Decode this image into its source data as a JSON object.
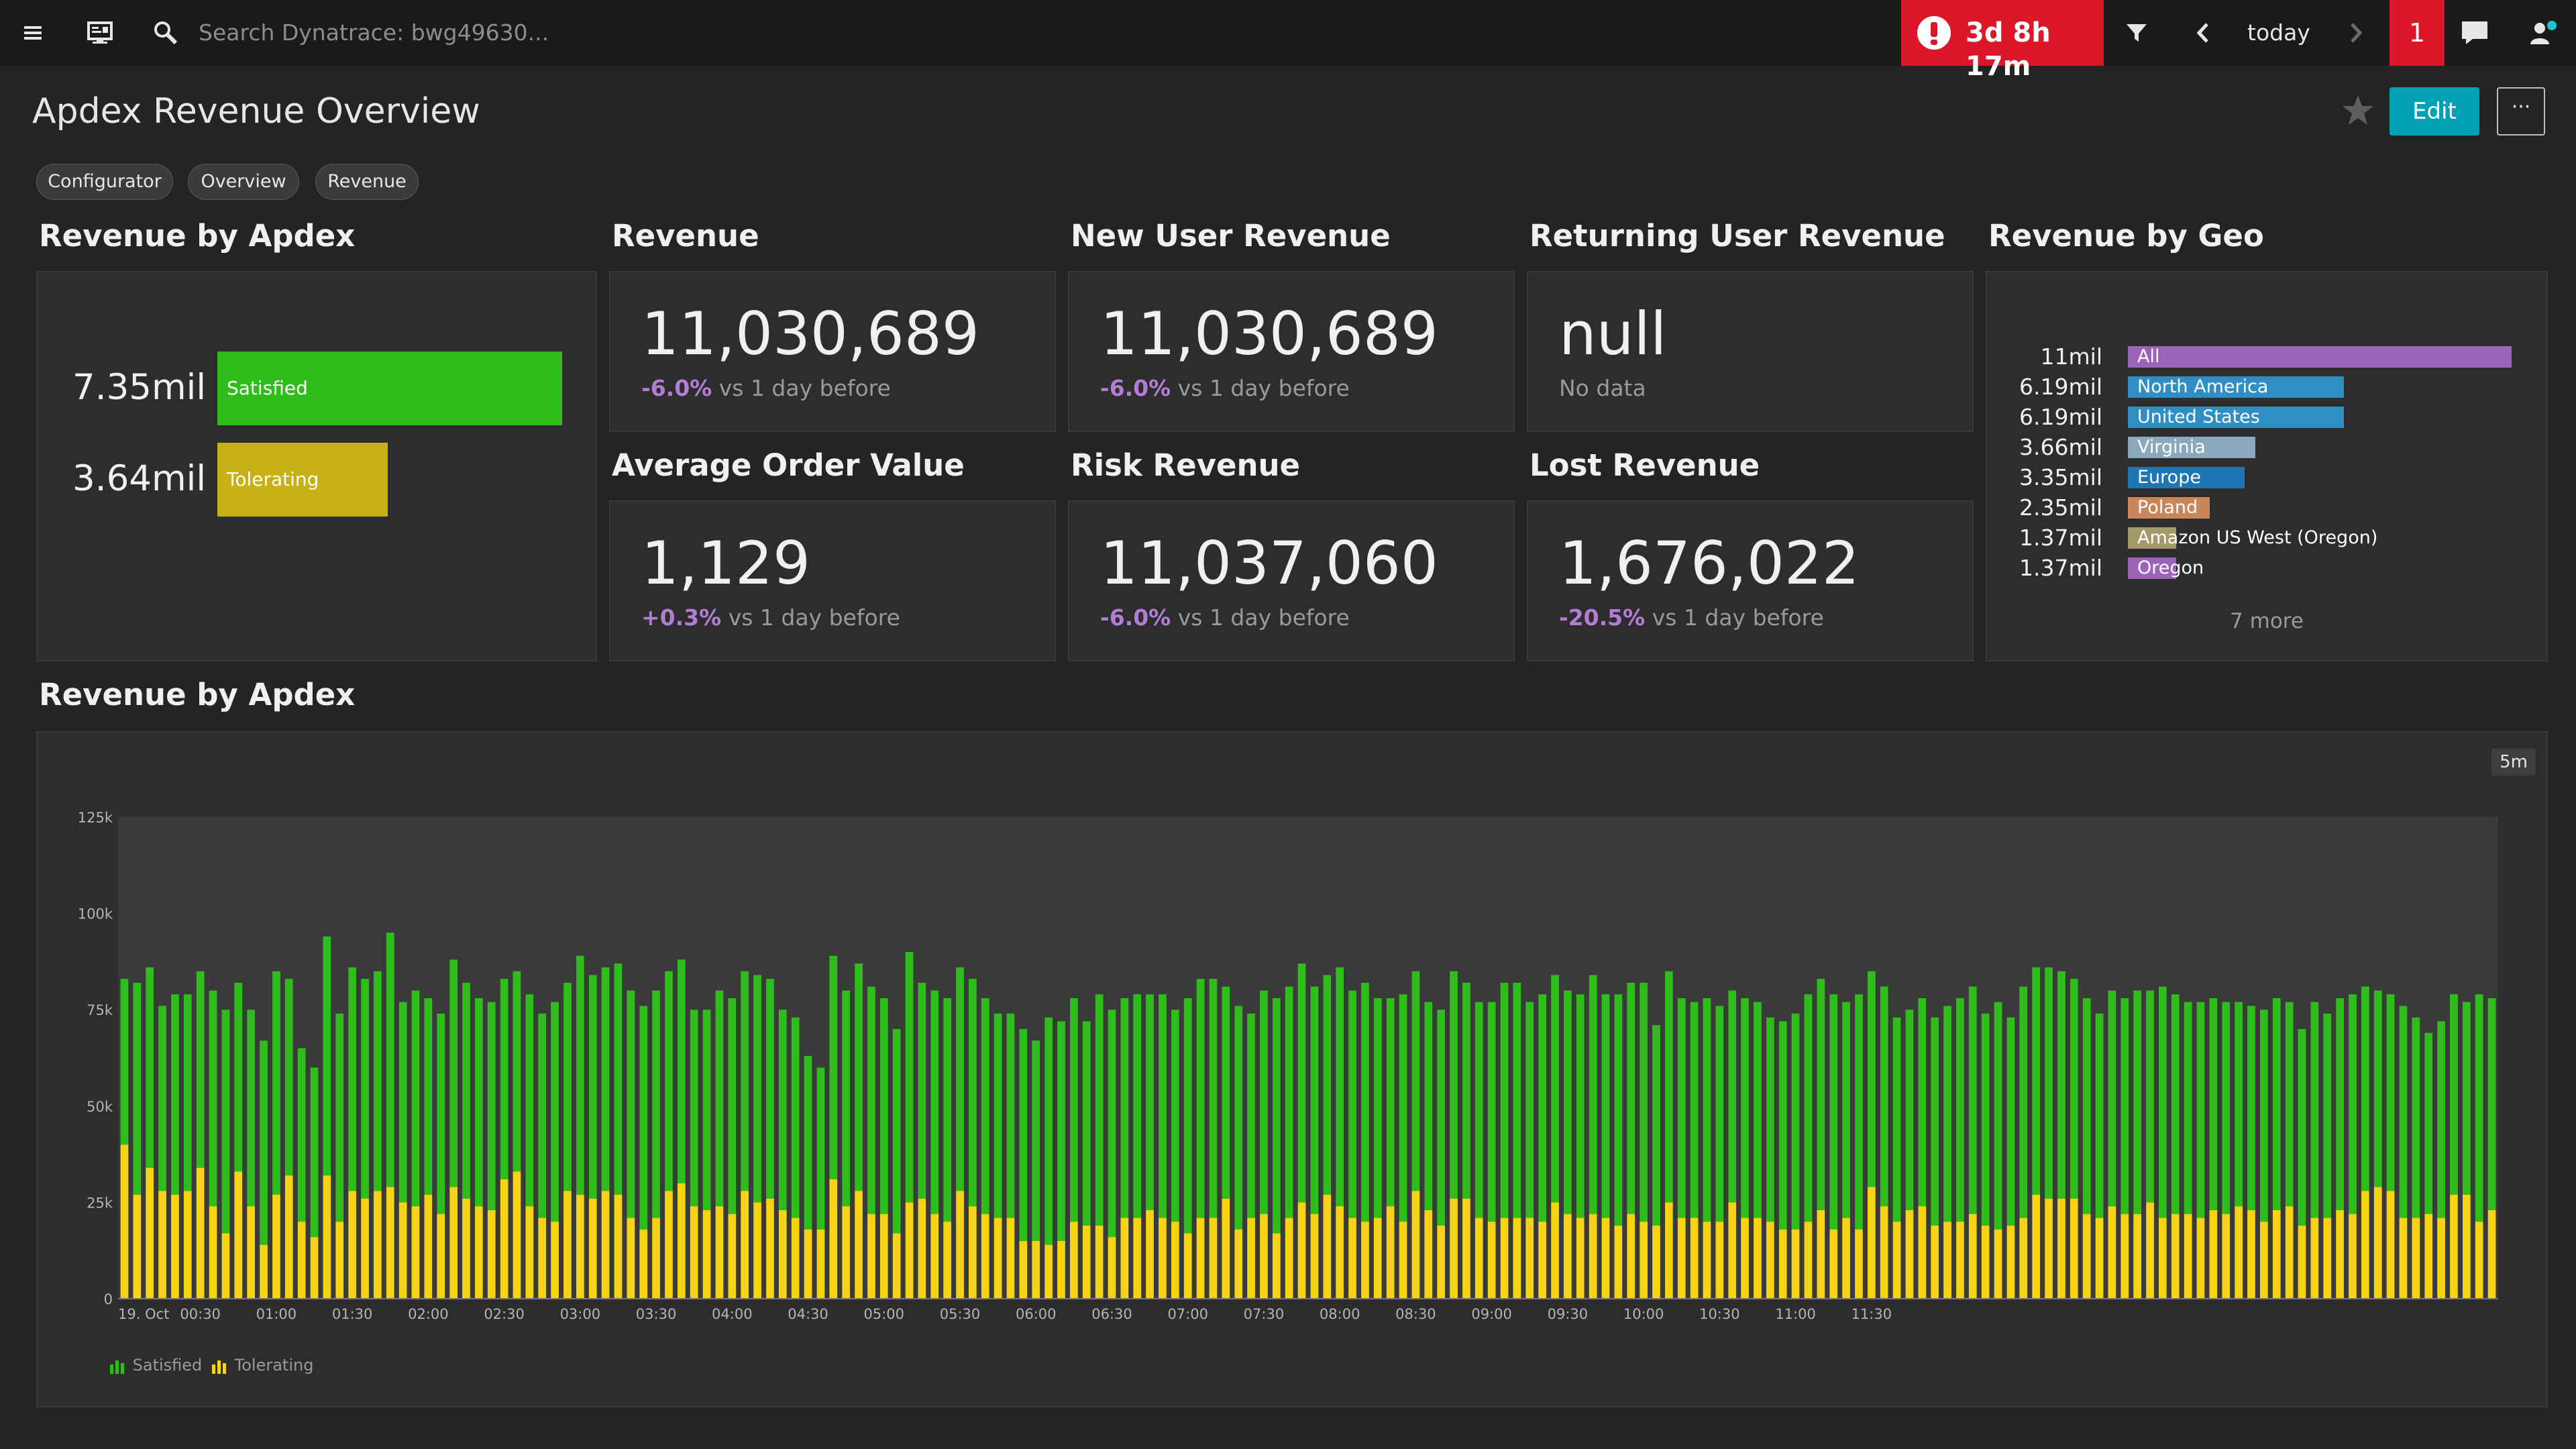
{
  "topbar": {
    "search_placeholder": "Search Dynatrace: bwg49630...",
    "problem_duration": "3d 8h 17m",
    "timeframe_label": "today",
    "notification_count": "1"
  },
  "header": {
    "title": "Apdex Revenue Overview",
    "edit_label": "Edit",
    "more_label": "···"
  },
  "tags": [
    "Configurator",
    "Overview",
    "Revenue"
  ],
  "tiles": {
    "revenue_by_apdex": {
      "title": "Revenue by Apdex",
      "rows": [
        {
          "value": "7.35mil",
          "label": "Satisfied",
          "color": "#2ebd1b",
          "fraction": 1.0
        },
        {
          "value": "3.64mil",
          "label": "Tolerating",
          "color": "#c7b014",
          "fraction": 0.495
        }
      ]
    },
    "revenue": {
      "title": "Revenue",
      "value": "11,030,689",
      "change": "-6.0%",
      "compare": "vs 1 day before"
    },
    "new_user_revenue": {
      "title": "New User Revenue",
      "value": "11,030,689",
      "change": "-6.0%",
      "compare": "vs 1 day before"
    },
    "returning_user_revenue": {
      "title": "Returning User Revenue",
      "value": "null",
      "note": "No data"
    },
    "average_order_value": {
      "title": "Average Order Value",
      "value": "1,129",
      "change": "+0.3%",
      "compare": "vs 1 day before"
    },
    "risk_revenue": {
      "title": "Risk Revenue",
      "value": "11,037,060",
      "change": "-6.0%",
      "compare": "vs 1 day before"
    },
    "lost_revenue": {
      "title": "Lost Revenue",
      "value": "1,676,022",
      "change": "-20.5%",
      "compare": "vs 1 day before"
    },
    "revenue_by_geo": {
      "title": "Revenue by Geo",
      "rows": [
        {
          "value": "11mil",
          "label": "All",
          "color": "#9c63b8",
          "fraction": 1.0
        },
        {
          "value": "6.19mil",
          "label": "North America",
          "color": "#2f8ec4",
          "fraction": 0.563
        },
        {
          "value": "6.19mil",
          "label": "United States",
          "color": "#2f8ec4",
          "fraction": 0.563
        },
        {
          "value": "3.66mil",
          "label": "Virginia",
          "color": "#8ba9bd",
          "fraction": 0.333
        },
        {
          "value": "3.35mil",
          "label": "Europe",
          "color": "#1f76b4",
          "fraction": 0.305
        },
        {
          "value": "2.35mil",
          "label": "Poland",
          "color": "#c8865a",
          "fraction": 0.214
        },
        {
          "value": "1.37mil",
          "label": "Amazon US West (Oregon)",
          "color": "#a39a6a",
          "fraction": 0.125
        },
        {
          "value": "1.37mil",
          "label": "Oregon",
          "color": "#9c63b8",
          "fraction": 0.125
        }
      ],
      "more": "7 more"
    }
  },
  "chart_section": {
    "title": "Revenue by Apdex",
    "interval": "5m"
  },
  "chart_data": {
    "type": "bar",
    "stacked": true,
    "ylim": [
      0,
      125000
    ],
    "y_ticks": [
      "0",
      "25k",
      "50k",
      "75k",
      "100k",
      "125k"
    ],
    "x_tick_labels": [
      "19. Oct",
      "00:30",
      "01:00",
      "01:30",
      "02:00",
      "02:30",
      "03:00",
      "03:30",
      "04:00",
      "04:30",
      "05:00",
      "05:30",
      "06:00",
      "06:30",
      "07:00",
      "07:30",
      "08:00",
      "08:30",
      "09:00",
      "09:30",
      "10:00",
      "10:30",
      "11:00",
      "11:30"
    ],
    "x_start_minutes": 0,
    "interval_minutes": 5,
    "series": [
      {
        "name": "Satisfied",
        "color": "#2ebd1b",
        "values": [
          43000,
          55000,
          52000,
          48000,
          52000,
          51000,
          51000,
          56000,
          58000,
          49000,
          51000,
          53000,
          58000,
          51000,
          45000,
          44000,
          62000,
          54000,
          58000,
          57000,
          57000,
          66000,
          52000,
          56000,
          51000,
          52000,
          59000,
          56000,
          54000,
          54000,
          52000,
          52000,
          55000,
          53000,
          57000,
          54000,
          62000,
          58000,
          58000,
          60000,
          59000,
          58000,
          59000,
          57000,
          58000,
          51000,
          52000,
          56000,
          56000,
          57000,
          59000,
          57000,
          52000,
          52000,
          45000,
          42000,
          58000,
          56000,
          59000,
          59000,
          56000,
          53000,
          65000,
          56000,
          58000,
          58000,
          58000,
          59000,
          56000,
          53000,
          53000,
          55000,
          52000,
          59000,
          57000,
          58000,
          53000,
          60000,
          59000,
          57000,
          58000,
          56000,
          58000,
          55000,
          61000,
          62000,
          62000,
          55000,
          58000,
          53000,
          58000,
          61000,
          60000,
          62000,
          59000,
          57000,
          62000,
          59000,
          62000,
          57000,
          54000,
          59000,
          57000,
          54000,
          56000,
          59000,
          56000,
          56000,
          57000,
          61000,
          61000,
          56000,
          59000,
          59000,
          58000,
          58000,
          62000,
          58000,
          60000,
          60000,
          62000,
          52000,
          60000,
          57000,
          56000,
          58000,
          56000,
          55000,
          57000,
          56000,
          53000,
          54000,
          56000,
          59000,
          60000,
          61000,
          56000,
          61000,
          56000,
          57000,
          53000,
          52000,
          54000,
          54000,
          56000,
          58000,
          59000,
          55000,
          59000,
          54000,
          60000,
          59000,
          60000,
          59000,
          57000,
          56000,
          53000,
          56000,
          56000,
          58000,
          55000,
          60000,
          57000,
          55000,
          56000,
          55000,
          55000,
          53000,
          53000,
          55000,
          55000,
          53000,
          51000,
          56000,
          53000,
          55000,
          57000,
          53000,
          51000,
          51000,
          55000,
          52000,
          47000,
          51000,
          52000,
          50000,
          59000,
          55000
        ],
        "tolerating_hint": null
      },
      {
        "name": "Tolerating",
        "color": "#f7d316",
        "values": [
          40000,
          27000,
          34000,
          28000,
          27000,
          28000,
          34000,
          24000,
          17000,
          33000,
          24000,
          14000,
          27000,
          32000,
          20000,
          16000,
          32000,
          20000,
          28000,
          26000,
          28000,
          29000,
          25000,
          24000,
          27000,
          22000,
          29000,
          26000,
          24000,
          23000,
          31000,
          33000,
          24000,
          21000,
          20000,
          28000,
          27000,
          26000,
          28000,
          27000,
          21000,
          18000,
          21000,
          28000,
          30000,
          24000,
          23000,
          24000,
          22000,
          28000,
          25000,
          26000,
          23000,
          21000,
          18000,
          18000,
          31000,
          24000,
          28000,
          22000,
          22000,
          17000,
          25000,
          26000,
          22000,
          20000,
          28000,
          24000,
          22000,
          21000,
          21000,
          15000,
          15000,
          14000,
          15000,
          20000,
          19000,
          19000,
          16000,
          21000,
          21000,
          23000,
          21000,
          20000,
          17000,
          21000,
          21000,
          26000,
          18000,
          21000,
          22000,
          17000,
          21000,
          25000,
          22000,
          27000,
          24000,
          21000,
          20000,
          21000,
          24000,
          20000,
          28000,
          23000,
          19000,
          26000,
          26000,
          21000,
          20000,
          21000,
          21000,
          21000,
          20000,
          25000,
          22000,
          21000,
          22000,
          21000,
          19000,
          22000,
          20000,
          19000,
          25000,
          21000,
          21000,
          20000,
          20000,
          25000,
          21000,
          21000,
          20000,
          18000,
          18000,
          20000,
          23000,
          18000,
          21000,
          18000,
          29000,
          24000,
          20000,
          23000,
          24000,
          19000,
          20000,
          20000,
          22000,
          19000,
          18000,
          19000,
          21000,
          27000,
          26000,
          26000,
          26000,
          22000,
          21000,
          24000,
          22000,
          22000,
          25000,
          21000,
          22000,
          22000,
          21000,
          23000,
          22000,
          24000,
          23000,
          20000,
          23000,
          24000,
          19000,
          21000,
          21000,
          23000,
          22000,
          28000,
          29000,
          28000,
          21000,
          21000,
          22000,
          21000,
          27000,
          27000,
          20000,
          23000,
          21000,
          25000,
          24000
        ]
      }
    ]
  },
  "legend": {
    "satisfied": "Satisfied",
    "tolerating": "Tolerating"
  }
}
